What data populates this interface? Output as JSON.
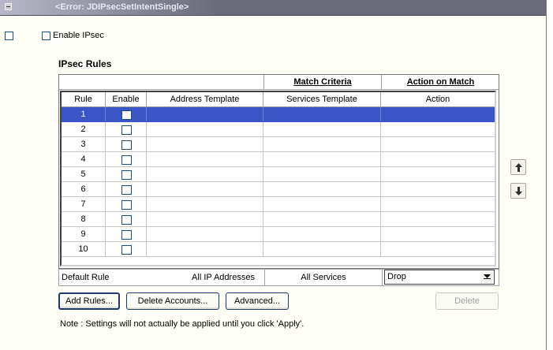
{
  "window": {
    "title": "<Error: JDIPsecSetIntentSingle>"
  },
  "top_checkbox": {
    "checked": false
  },
  "enable_ipsec": {
    "label": "Enable IPsec",
    "checked": false
  },
  "section_title": "IPsec Rules",
  "group_headers": {
    "match_criteria": "Match Criteria",
    "action_on_match": "Action on Match"
  },
  "columns": {
    "rule": "Rule",
    "enable": "Enable",
    "address_template": "Address Template",
    "services_template": "Services Template",
    "action": "Action"
  },
  "rows": [
    {
      "rule": "1",
      "enabled": false,
      "selected": true
    },
    {
      "rule": "2",
      "enabled": false
    },
    {
      "rule": "3",
      "enabled": false
    },
    {
      "rule": "4",
      "enabled": false
    },
    {
      "rule": "5",
      "enabled": false
    },
    {
      "rule": "6",
      "enabled": false
    },
    {
      "rule": "7",
      "enabled": false
    },
    {
      "rule": "8",
      "enabled": false
    },
    {
      "rule": "9",
      "enabled": false
    },
    {
      "rule": "10",
      "enabled": false
    }
  ],
  "default_rule": {
    "label": "Default Rule",
    "address": "All IP Addresses",
    "services": "All Services",
    "action": "Drop"
  },
  "buttons": {
    "add_rules": "Add Rules...",
    "delete_accounts": "Delete Accounts...",
    "advanced": "Advanced...",
    "delete": "Delete"
  },
  "note": "Note : Settings will not actually be applied until you click 'Apply'.",
  "colors": {
    "selection": "#3a56c6",
    "title_bar": "#6a6a78",
    "background": "#fffff7"
  },
  "icons": {
    "move_up": "arrow-up-icon",
    "move_down": "arrow-down-icon",
    "collapse": "collapse-icon"
  }
}
